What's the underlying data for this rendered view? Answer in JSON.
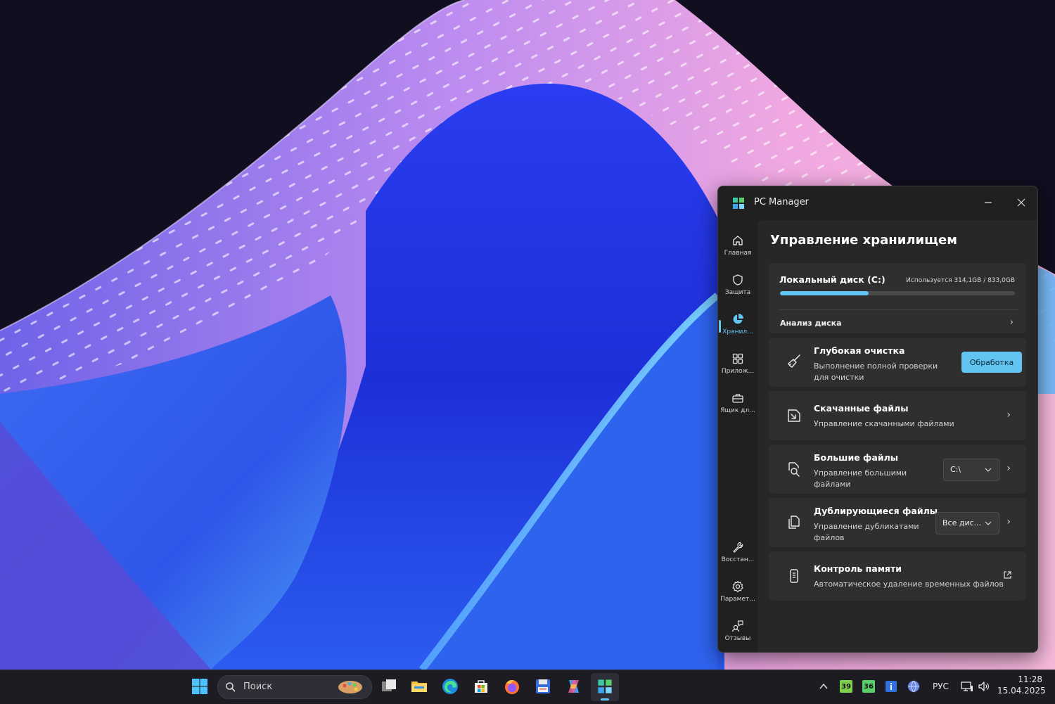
{
  "window": {
    "title": "PC Manager",
    "accent": "#62c4f0"
  },
  "nav": {
    "items": [
      {
        "label": "Главная",
        "icon": "home-icon"
      },
      {
        "label": "Защита",
        "icon": "shield-icon"
      },
      {
        "label": "Хранил...",
        "icon": "pie-chart-icon"
      },
      {
        "label": "Прилож...",
        "icon": "apps-grid-icon"
      },
      {
        "label": "Ящик дл...",
        "icon": "toolbox-icon"
      }
    ],
    "bottom_items": [
      {
        "label": "Восстан...",
        "icon": "wrench-icon"
      },
      {
        "label": "Парамет...",
        "icon": "gear-icon"
      },
      {
        "label": "Отзывы",
        "icon": "feedback-icon"
      }
    ],
    "active_index": 2
  },
  "page": {
    "title": "Управление хранилищем"
  },
  "disk": {
    "name": "Локальный диск (C:)",
    "usage": "Используется 314,1GB / 833,0GB",
    "used_fraction": 0.377,
    "analysis_link": "Анализ диска"
  },
  "rows": {
    "deep_clean": {
      "title": "Глубокая очистка",
      "desc": "Выполнение полной проверки для очистки",
      "button": "Обработка"
    },
    "downloads": {
      "title": "Скачанные файлы",
      "desc": "Управление скачанными файлами"
    },
    "large_files": {
      "title": "Большие файлы",
      "desc": "Управление большими файлами",
      "dropdown": "C:\\"
    },
    "duplicates": {
      "title": "Дублирующиеся файлы",
      "desc": "Управление дубликатами файлов",
      "dropdown": "Все дис..."
    },
    "storage_sense": {
      "title": "Контроль памяти",
      "desc": "Автоматическое удаление временных файлов"
    }
  },
  "taskbar": {
    "search_placeholder": "Поиск",
    "badge_1": "39",
    "badge_2": "36",
    "language": "РУС",
    "time": "11:28",
    "date": "15.04.2025"
  }
}
